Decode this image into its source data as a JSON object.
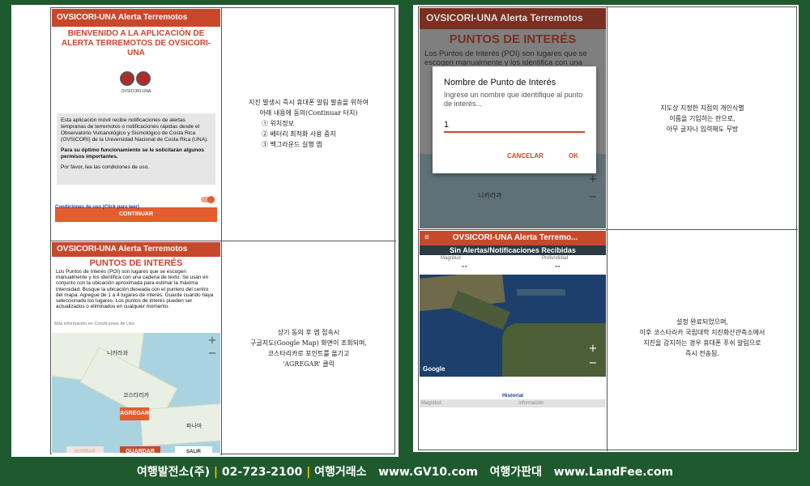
{
  "left": {
    "screen1": {
      "appbar_title": "OVSICORI-UNA Alerta Terremotos",
      "welcome_title": "BIENVENIDO A LA APLICACIÓN DE ALERTA TERREMOTOS DE OVSICORI-UNA",
      "logo_caption": "OVSICORI-UNA",
      "intro_p1": "Esta aplicación móvil recibe notificaciones de alertas tempranas de terremotos o notificaciones rápidas desde el Observatorio Vulcanológico y Sismológico de Costa Rica (OVSICORI) de la Universidad Nacional de Costa Rica (UNA).",
      "intro_p2": "Para su óptimo funcionamiento se le solicitarán algunos permisos importantes.",
      "intro_p3": "Por favor, lea las condiciones de uso.",
      "conditions_label": "Condiciones de uso (Click para leer)",
      "continue_label": "CONTINUAR"
    },
    "note1": [
      "지진 발생시 즉시 휴대폰 알림 발송을 위하여",
      "아래 내용에 동의(Continuar 터치)",
      "① 위치정보",
      "② 베터리 최적화 사용 중지",
      "③ 백그라운드 실행 앱"
    ],
    "screen2": {
      "appbar_title": "OVSICORI-UNA Alerta Terremotos",
      "poi_title": "PUNTOS DE INTERÉS",
      "poi_text": "Los Puntos de Interés (POI) son lugares que se escogen manualmente y los identifica con una cadena de texto. Se usan en conjunto con la ubicación aproximada para estimar la máxima intensidad. Busque la ubicación deseada con el puntero del centro del mapa. Agregue de 1 a 4 lugares de interés. Guarde cuando haya seleccionado los lugares. Los puntos de interés pueden ser actualizados o eliminados en cualquier momento.",
      "more_info": "Más información en Condiciones de Uso",
      "map_label_nicaragua": "니카라과",
      "map_label_costarica": "코스타리카",
      "map_label_panama": "파나마",
      "agregar_label": "AGREGAR",
      "borrar_label": "BORRAR",
      "guardar_label": "GUARDAR",
      "salir_label": "SALIR"
    },
    "note2": [
      "상기 동의 후 앱 접속시",
      "구글지도(Google Map) 화면이 조회되며,",
      "코스타리카로 포인트를 옮기고",
      "'AGREGAR' 클릭"
    ]
  },
  "right": {
    "screen3": {
      "appbar_title": "OVSICORI-UNA Alerta Terremotos",
      "poi_title": "PUNTOS DE INTERÉS",
      "poi_text_partial": "Los Puntos de Interés (POI) son lugares que se escogen manualmente y los identifica con una",
      "dialog_title": "Nombre de Punto de Interés",
      "dialog_body": "Ingrese un nombre que identifique al punto de interés...",
      "dialog_input_value": "1",
      "cancel_label": "CANCELAR",
      "ok_label": "OK",
      "map_label_nicaragua": "니카라과"
    },
    "note3": [
      "지도상 지정한 지점의 개인식별",
      "이름을 기입하는 란으로,",
      "아무 글자나 입력해도 무방"
    ],
    "screen4": {
      "appbar_title": "OVSICORI-UNA Alerta Terremo...",
      "section_title": "Sin Alertas/Notificaciones Recibidas",
      "col_magnitud": "Magnitud",
      "col_profundidad": "Profundidad",
      "val_magnitud": "--",
      "val_profundidad": "--",
      "google_label": "Google",
      "historial_label": "Historial",
      "hist_col_magnitud": "Magnitud",
      "hist_col_informacion": "Información"
    },
    "note4": [
      "설정 완료되었으며,",
      "이후 코스타리카 국립대학 지진화산관측소에서",
      "지진을 감지하는 경우 휴대폰 푸쉬 알림으로",
      "즉시 전송됨."
    ]
  },
  "footer": {
    "company": "여행발전소(주)",
    "phone": "02-723-2100",
    "exchange": "여행거래소",
    "exchange_url": "www.GV10.com",
    "price_board": "여행가판대",
    "price_url": "www.LandFee.com"
  },
  "colors": {
    "brand_red": "#c8482c",
    "button_orange": "#e35d2f",
    "background_green": "#1f5a2e",
    "footer_yellow": "#f2c400"
  }
}
